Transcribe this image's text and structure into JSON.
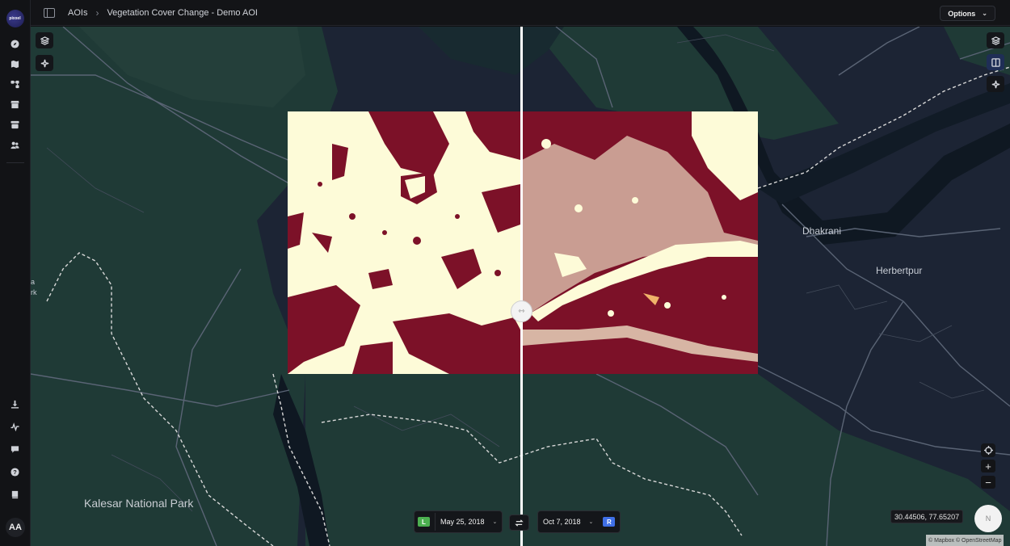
{
  "app": {
    "logo_text": "pixxel"
  },
  "breadcrumb": {
    "root": "AOIs",
    "separator": "›",
    "current": "Vegetation Cover Change - Demo AOI"
  },
  "toolbar": {
    "options_label": "Options"
  },
  "user": {
    "initials": "AA"
  },
  "map": {
    "places": [
      {
        "label": "Dhakrani"
      },
      {
        "label": "Herbertpur"
      },
      {
        "label": "Kalesar National Park"
      },
      {
        "label": "a"
      },
      {
        "label": "rk"
      }
    ],
    "coordinates": "30.44506, 77.65207",
    "attribution": "© Mapbox © OpenStreetMap",
    "compass_label": "N"
  },
  "compare": {
    "left": {
      "tag": "L",
      "date": "May 25, 2018",
      "tag_color": "#4caf50"
    },
    "right": {
      "tag": "R",
      "date": "Oct 7, 2018",
      "tag_color": "#3f6fe6"
    }
  },
  "colors": {
    "change_class": "#7c1128",
    "stable_class": "#fdfbd8",
    "map_land": "#1f3a36",
    "map_water": "#1c2434"
  }
}
